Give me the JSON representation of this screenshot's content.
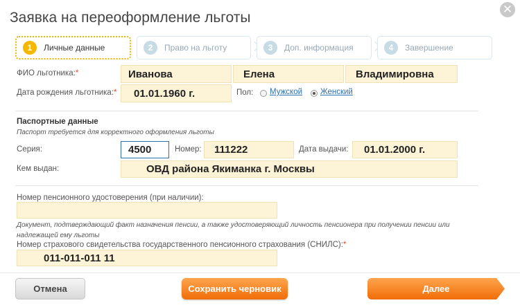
{
  "dialog": {
    "title": "Заявка на переоформление льготы",
    "close_glyph": "✕"
  },
  "steps": [
    {
      "num": "1",
      "label": "Личные данные",
      "active": true
    },
    {
      "num": "2",
      "label": "Право на льготу",
      "active": false
    },
    {
      "num": "3",
      "label": "Доп. информация",
      "active": false
    },
    {
      "num": "4",
      "label": "Завершение",
      "active": false
    }
  ],
  "person": {
    "fio_label": "ФИО льготника:",
    "last_name": "Иванова",
    "first_name": "Елена",
    "middle_name": "Владимировна",
    "birth_label": "Дата рождения льготника:",
    "birth_date": "01.01.1960 г.",
    "gender_label": "Пол:",
    "gender_male": "Мужской",
    "gender_female": "Женский",
    "gender_selected": "Женский"
  },
  "passport": {
    "title": "Паспортные данные",
    "hint": "Паспорт требуется для корректного оформления льготы",
    "series_label": "Серия:",
    "series": "4500",
    "number_label": "Номер:",
    "number": "111222",
    "issue_date_label": "Дата выдачи:",
    "issue_date": "01.01.2000 г.",
    "issued_by_label": "Кем выдан:",
    "issued_by": "ОВД района Якиманка г. Москвы"
  },
  "pension": {
    "cert_label": "Номер пенсионного удостоверения (при наличии):",
    "cert_value": "",
    "cert_hint": "Документ, подтверждающий факт назначения пенсии, а также удостоверяющий личность пенсионера при получении пенсии или надлежащей ему льготы",
    "snils_label": "Номер страхового свидетельства государственного пенсионного страхования (СНИЛС):",
    "snils_value": "011-011-011 11"
  },
  "footer": {
    "cancel": "Отмена",
    "save_draft": "Сохранить черновик",
    "next": "Далее"
  },
  "colors": {
    "accent_orange": "#f06d08",
    "field_fill": "#fdf3d6",
    "active_step": "#f5b800"
  }
}
